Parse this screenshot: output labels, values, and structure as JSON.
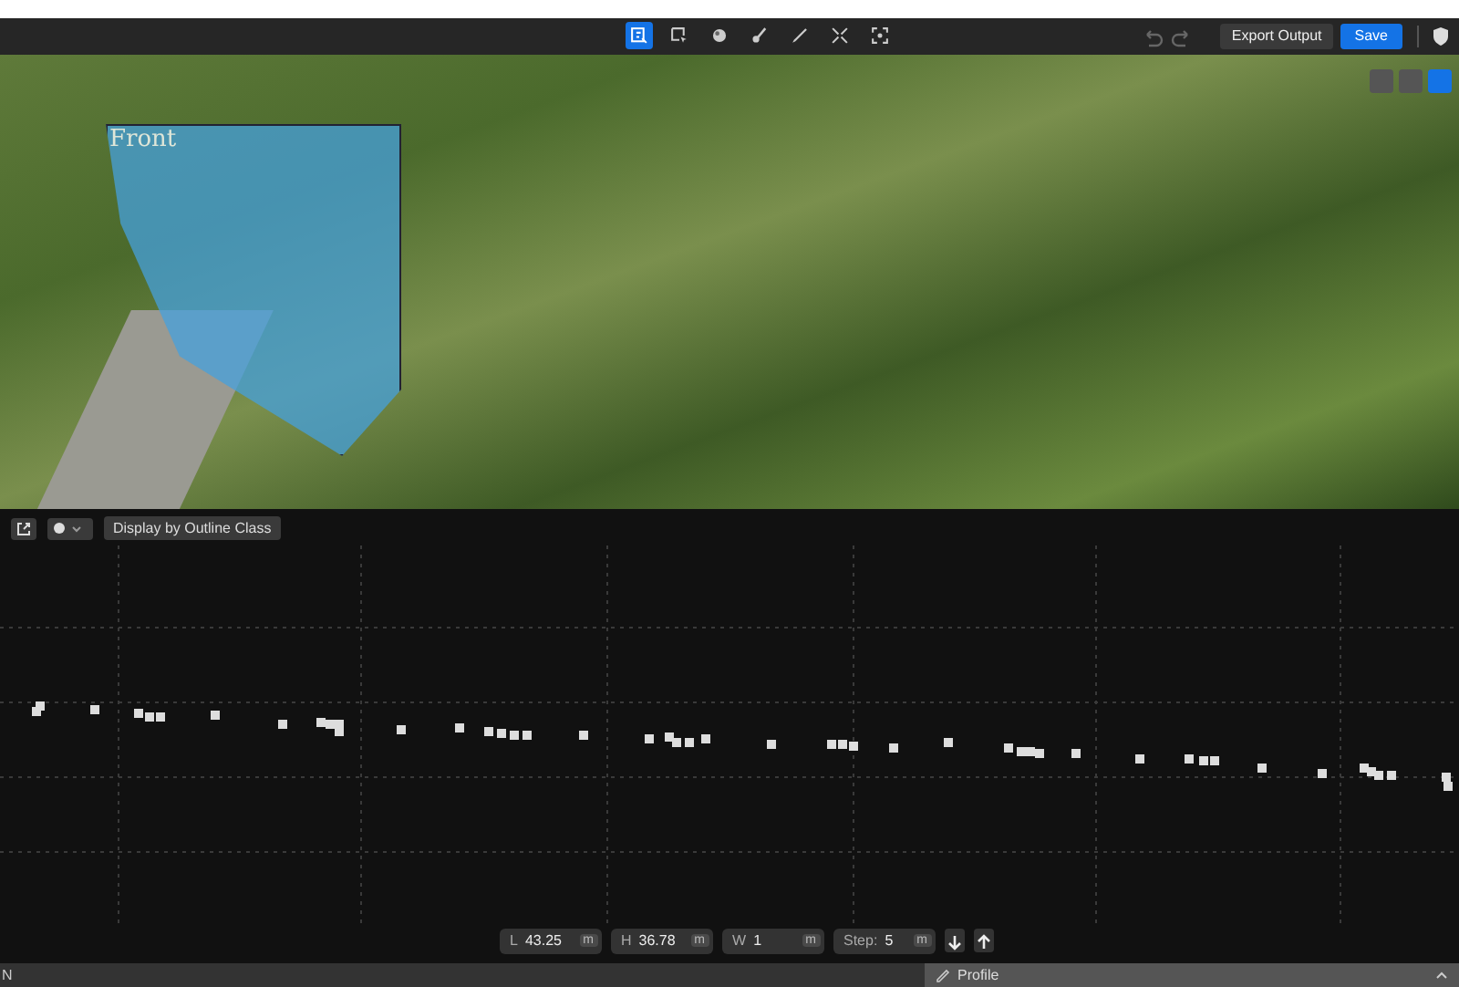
{
  "toolbar": {
    "tools": [
      {
        "kind": "frame",
        "selected": true
      },
      {
        "kind": "select",
        "selected": false
      },
      {
        "kind": "sphere",
        "selected": false
      },
      {
        "kind": "brush",
        "selected": false
      },
      {
        "kind": "pen",
        "selected": false
      },
      {
        "kind": "expand",
        "selected": false
      },
      {
        "kind": "fit",
        "selected": false
      }
    ],
    "history": [
      {
        "kind": "undo",
        "disabled": true
      },
      {
        "kind": "redo",
        "disabled": true
      }
    ],
    "export_button": "Export Output",
    "save_button": "Save"
  },
  "viewport": {
    "plane_label": "Front",
    "view_buttons": [
      {
        "selected": false
      },
      {
        "selected": false
      },
      {
        "selected": true
      }
    ]
  },
  "profile_panel": {
    "display_select": "Display by Outline Class",
    "fields": [
      {
        "label": "L",
        "value": "43.25",
        "unit": "m"
      },
      {
        "label": "H",
        "value": "36.78",
        "unit": "m"
      },
      {
        "label": "W",
        "value": "1",
        "unit": "m"
      },
      {
        "label": "Step:",
        "value": "5",
        "unit": "m"
      }
    ]
  },
  "status_bar": {
    "left_text": "N",
    "panel_title": "Profile"
  }
}
